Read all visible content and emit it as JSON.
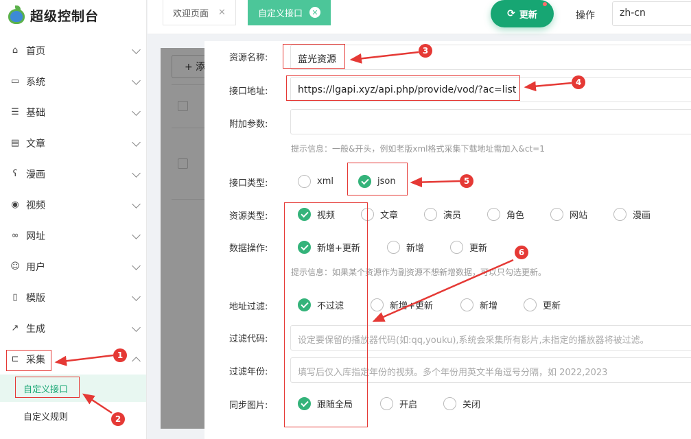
{
  "app": {
    "title": "超级控制台"
  },
  "sidebar": {
    "items": [
      {
        "label": "首页",
        "icon": "home-icon"
      },
      {
        "label": "系统",
        "icon": "monitor-icon"
      },
      {
        "label": "基础",
        "icon": "list-icon"
      },
      {
        "label": "文章",
        "icon": "document-icon"
      },
      {
        "label": "漫画",
        "icon": "bear-icon"
      },
      {
        "label": "视频",
        "icon": "play-icon"
      },
      {
        "label": "网址",
        "icon": "link-icon"
      },
      {
        "label": "用户",
        "icon": "user-icon"
      },
      {
        "label": "模版",
        "icon": "template-icon"
      },
      {
        "label": "生成",
        "icon": "generate-icon"
      },
      {
        "label": "采集",
        "icon": "collect-icon"
      }
    ],
    "sub_items": [
      "自定义接口",
      "自定义规则"
    ]
  },
  "topbar": {
    "tabs": [
      {
        "label": "欢迎页面"
      },
      {
        "label": "自定义接口"
      }
    ],
    "update_label": "更新",
    "ops_label": "操作",
    "language": "zh-cn"
  },
  "list": {
    "add_label": "+ 添"
  },
  "form": {
    "labels": {
      "name": "资源名称:",
      "url": "接口地址:",
      "param": "附加参数:",
      "api_type": "接口类型:",
      "res_type": "资源类型:",
      "data_op": "数据操作:",
      "url_filter": "地址过滤:",
      "filter_code": "过滤代码:",
      "filter_year": "过滤年份:",
      "sync_pic": "同步图片:"
    },
    "name_value": "蓝光资源",
    "url_value": "https://lgapi.xyz/api.php/provide/vod/?ac=list",
    "param_value": "",
    "param_hint": "提示信息：一般&开头，例如老版xml格式采集下载地址需加入&ct=1",
    "api_type": [
      "xml",
      "json"
    ],
    "api_type_selected": "json",
    "res_type": [
      "视频",
      "文章",
      "演员",
      "角色",
      "网站",
      "漫画"
    ],
    "res_type_selected": "视频",
    "data_op": [
      "新增+更新",
      "新增",
      "更新"
    ],
    "data_op_selected": "新增+更新",
    "data_op_hint": "提示信息：如果某个资源作为副资源不想新增数据，可以只勾选更新。",
    "url_filter": [
      "不过滤",
      "新增+更新",
      "新增",
      "更新"
    ],
    "url_filter_selected": "不过滤",
    "filter_code_placeholder": "设定要保留的播放器代码(如:qq,youku),系统会采集所有影片,未指定的播放器将被过滤。",
    "filter_year_placeholder": "填写后仅入库指定年份的视频。多个年份用英文半角逗号分隔，如 2022,2023",
    "sync_pic": [
      "跟随全局",
      "开启",
      "关闭"
    ],
    "sync_pic_selected": "跟随全局"
  },
  "annotations": [
    "1",
    "2",
    "3",
    "4",
    "5",
    "6"
  ],
  "colors": {
    "accent": "#17a673",
    "annotation": "#e53935"
  }
}
